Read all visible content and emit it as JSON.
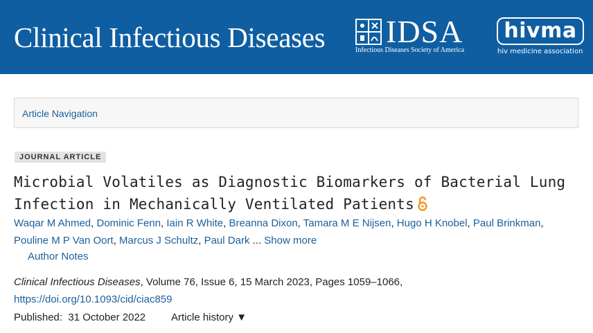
{
  "header": {
    "journal_title": "Clinical Infectious Diseases",
    "idsa_logo_text": "IDSA",
    "idsa_logo_subtitle": "Infectious Diseases Society of America",
    "hivma_logo_text": "hivma",
    "hivma_logo_subtitle": "hiv medicine association",
    "banner_color": "#0f5ea2"
  },
  "nav": {
    "article_navigation_label": "Article Navigation"
  },
  "article": {
    "type_badge": "JOURNAL ARTICLE",
    "title_line1": "Microbial Volatiles as Diagnostic Biomarkers of Bacterial Lung",
    "title_line2": "Infection in Mechanically Ventilated Patients",
    "open_access_icon": "open-access-lock",
    "open_access_color": "#f7931d",
    "authors": [
      "Waqar M Ahmed",
      "Dominic Fenn",
      "Iain R White",
      "Breanna Dixon",
      "Tamara M E Nijsen",
      "Hugo H Knobel",
      "Paul Brinkman",
      "Pouline M P Van Oort",
      "Marcus J Schultz",
      "Paul Dark"
    ],
    "ellipsis": "...",
    "show_more_label": "Show more",
    "author_notes_label": "Author Notes",
    "citation_journal": "Clinical Infectious Diseases",
    "citation_details": ", Volume 76, Issue 6, 15 March 2023, Pages 1059–1066,",
    "doi": "https://doi.org/10.1093/cid/ciac859",
    "published_label": "Published:",
    "published_date": "31 October 2022",
    "article_history_label": "Article history",
    "article_history_icon": "triangle-down-icon"
  },
  "colors": {
    "link": "#1a5f9a"
  }
}
